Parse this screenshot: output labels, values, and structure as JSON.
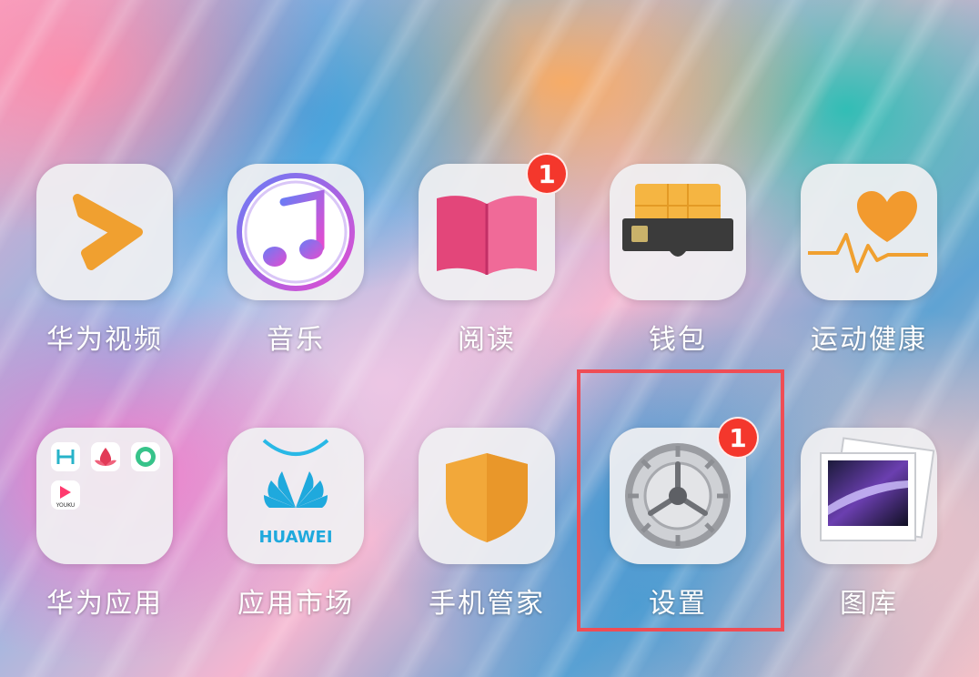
{
  "apps": {
    "huawei_video": {
      "label": "华为视频",
      "icon": "video-play-icon"
    },
    "music": {
      "label": "音乐",
      "icon": "music-note-icon"
    },
    "reading": {
      "label": "阅读",
      "icon": "open-book-icon",
      "badge": "1"
    },
    "wallet": {
      "label": "钱包",
      "icon": "wallet-card-icon"
    },
    "health": {
      "label": "运动健康",
      "icon": "heart-pulse-icon"
    },
    "huawei_apps_folder": {
      "label": "华为应用",
      "icon": "app-folder-icon",
      "folder_tile_text": "YOUKU"
    },
    "app_market": {
      "label": "应用市场",
      "icon": "huawei-bag-icon",
      "tile_text": "HUAWEI"
    },
    "phone_manager": {
      "label": "手机管家",
      "icon": "shield-icon"
    },
    "settings": {
      "label": "设置",
      "icon": "gear-icon",
      "badge": "1"
    },
    "gallery": {
      "label": "图库",
      "icon": "photo-icon"
    }
  },
  "colors": {
    "highlight": "#ef4d55",
    "badge": "#f4372c",
    "orange": "#f0a030"
  }
}
